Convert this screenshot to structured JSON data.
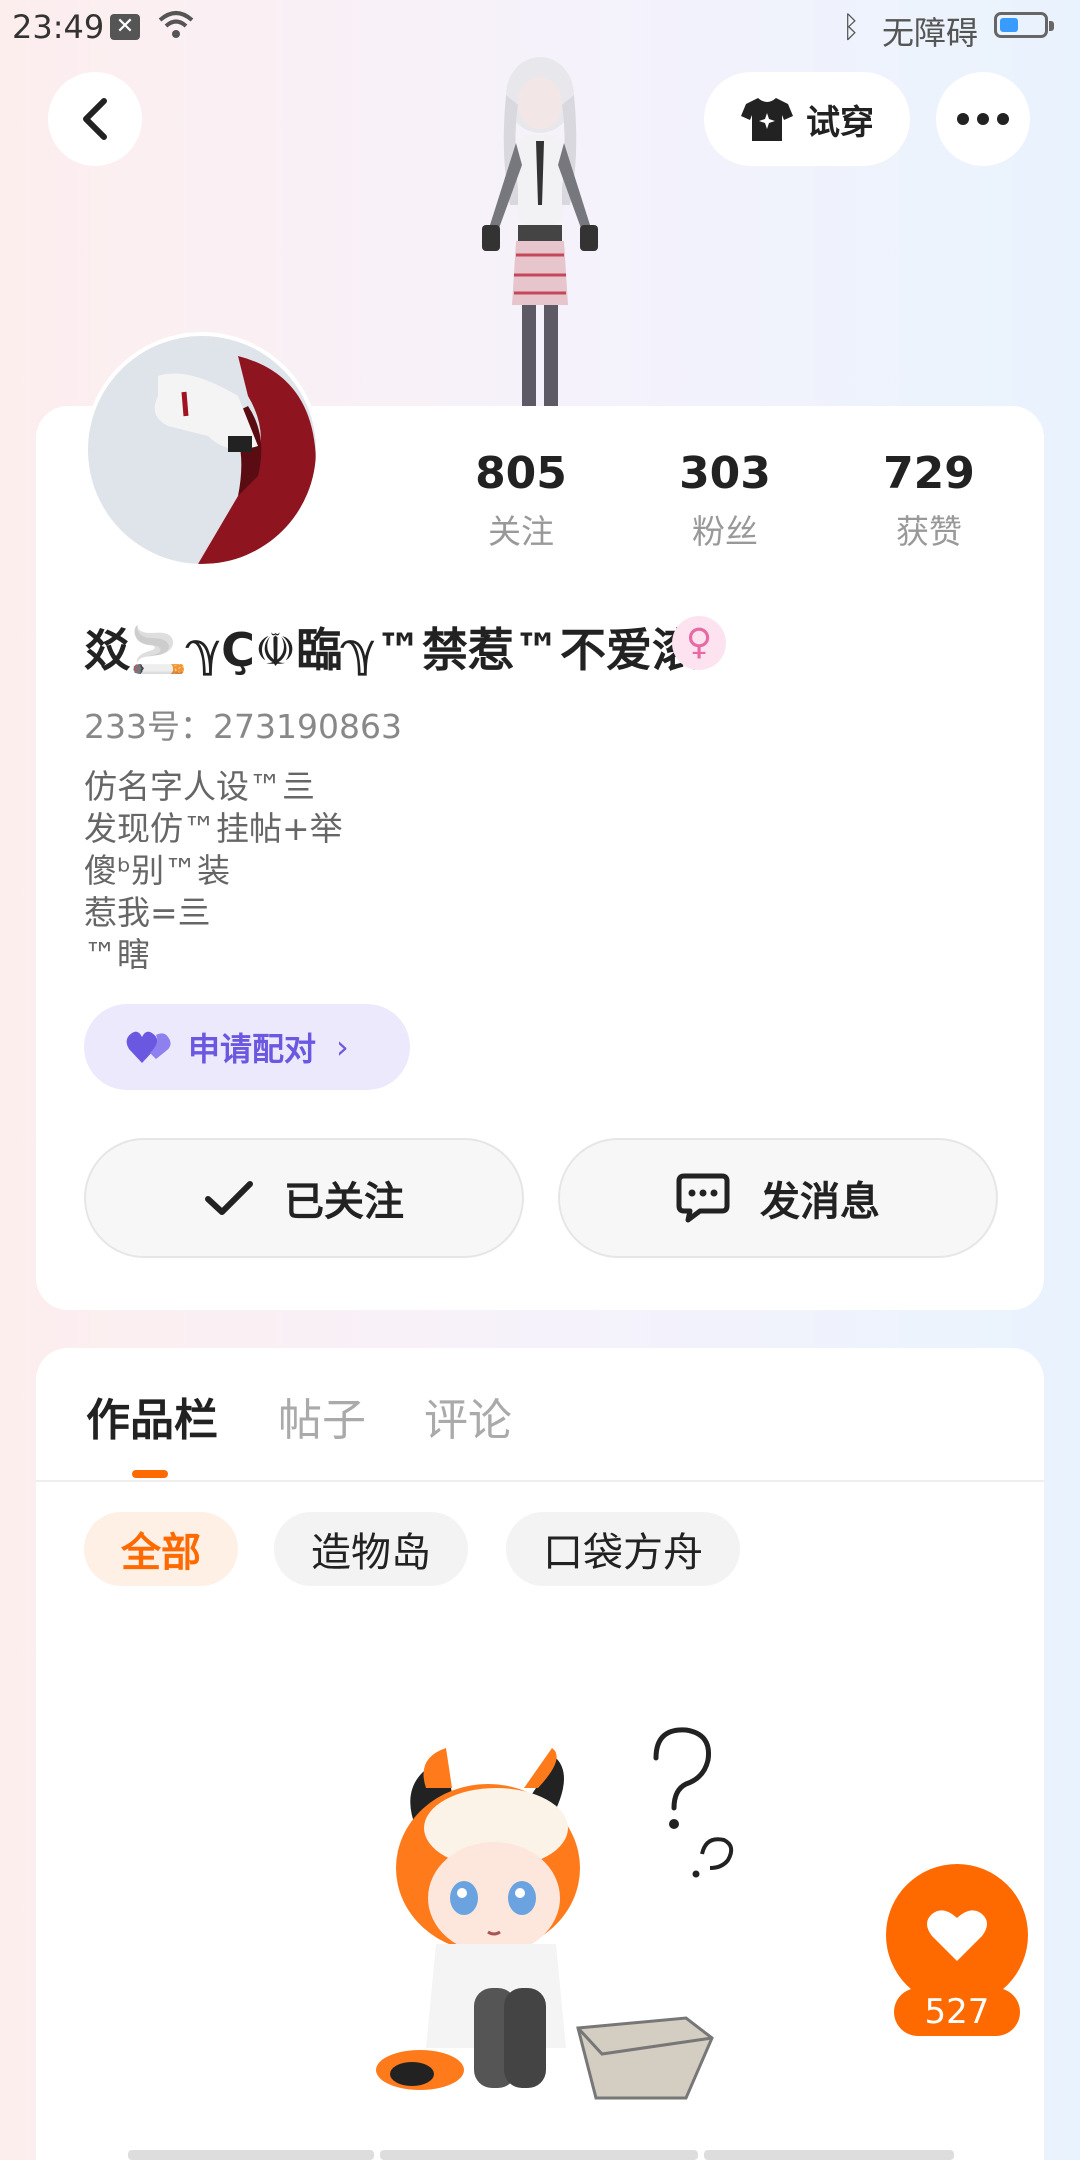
{
  "status_bar": {
    "time": "23:49",
    "accessibility": "无障碍"
  },
  "header": {
    "try_on_label": "试穿"
  },
  "profile": {
    "stats": [
      {
        "value": "805",
        "label": "关注"
      },
      {
        "value": "303",
        "label": "粉丝"
      },
      {
        "value": "729",
        "label": "获赞"
      }
    ],
    "name": "㸚🚬ℽÇ☫臨ℽ™禁惹™不爱滚",
    "uid": "233号：273190863",
    "bio": "仿名字人设™亖\n发现仿™挂帖+举\n傻ᵇ别™装\n惹我=亖\n™瞎",
    "pair_label": "申请配对",
    "follow_label": "已关注",
    "message_label": "发消息"
  },
  "content": {
    "tabs": [
      {
        "label": "作品栏",
        "active": true
      },
      {
        "label": "帖子",
        "active": false
      },
      {
        "label": "评论",
        "active": false
      }
    ],
    "filters": [
      {
        "label": "全部",
        "active": true
      },
      {
        "label": "造物岛",
        "active": false
      },
      {
        "label": "口袋方舟",
        "active": false
      }
    ]
  },
  "like": {
    "count": "527"
  },
  "colors": {
    "accent": "#ff6a00",
    "pair": "#6a58e0",
    "gender": "#e86aa4"
  }
}
